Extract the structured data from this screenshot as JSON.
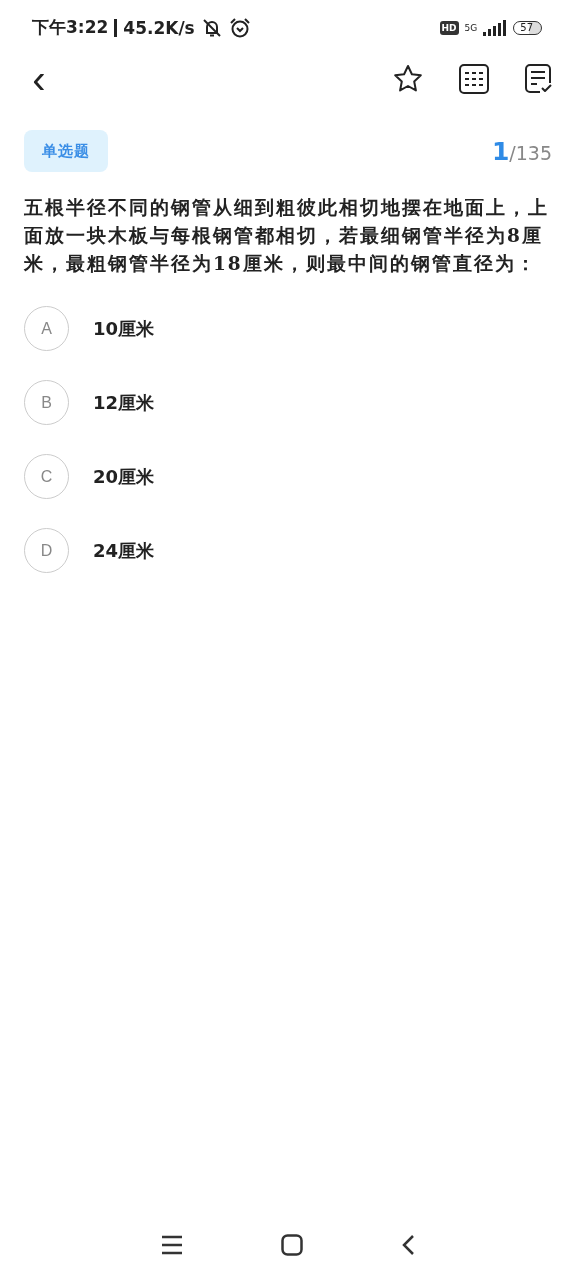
{
  "status_bar": {
    "time": "下午3:22",
    "speed": "45.2K/s",
    "hd_badge": "HD",
    "network": "5G",
    "battery": "57"
  },
  "header": {
    "back": "‹"
  },
  "question": {
    "type_tag": "单选题",
    "current": "1",
    "total": "/135",
    "text": "五根半径不同的钢管从细到粗彼此相切地摆在地面上，上面放一块木板与每根钢管都相切，若最细钢管半径为8厘米，最粗钢管半径为18厘米，则最中间的钢管直径为："
  },
  "options": [
    {
      "letter": "A",
      "text": "10厘米",
      "selected": false
    },
    {
      "letter": "B",
      "text": "12厘米",
      "selected": false
    },
    {
      "letter": "C",
      "text": "20厘米",
      "selected": false
    },
    {
      "letter": "D",
      "text": "24厘米",
      "selected": false
    }
  ]
}
